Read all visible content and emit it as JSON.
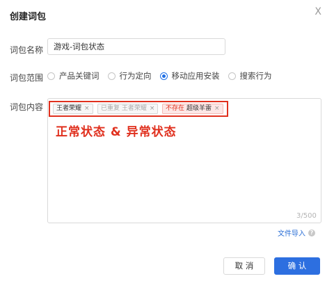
{
  "dialog": {
    "title": "创建词包",
    "close_glyph": "X"
  },
  "name_field": {
    "label": "词包名称",
    "value": "游戏-词包状态"
  },
  "scope": {
    "label": "词包范围",
    "options": [
      "产品关键词",
      "行为定向",
      "移动应用安装",
      "搜索行为"
    ],
    "selected": "移动应用安装"
  },
  "content": {
    "label": "词包内容",
    "tags": [
      {
        "prefix": "",
        "text": "王者荣耀",
        "remove": "×"
      },
      {
        "prefix": "",
        "text": "已重复 王者荣耀",
        "remove": "×"
      },
      {
        "prefix": "不存在",
        "text": "超级羊雷",
        "remove": "×"
      }
    ],
    "annotation": "正常状态 & 异常状态",
    "counter": "3/500"
  },
  "import": {
    "label": "文件导入",
    "help_glyph": "?"
  },
  "footer": {
    "cancel_label": "取 消",
    "confirm_label": "确 认"
  },
  "colors": {
    "primary": "#2d6fe0",
    "error": "#e0301e"
  }
}
